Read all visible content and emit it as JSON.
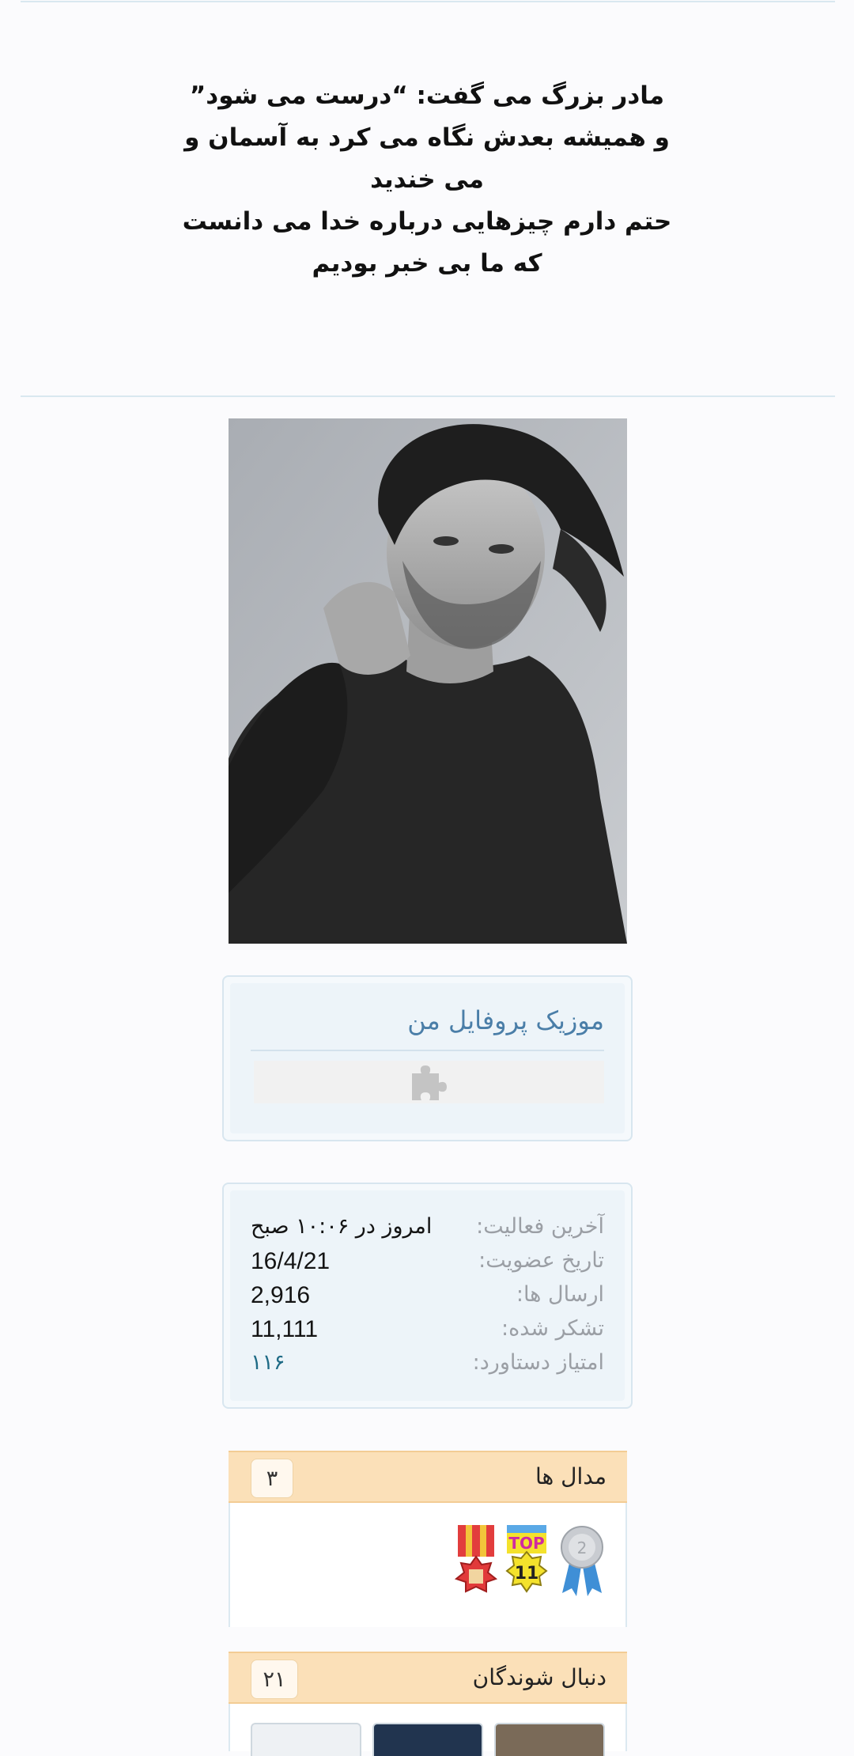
{
  "quote": {
    "line1": "مادر بزرگ می گفت: “درست می شود”",
    "line2": "و همیشه بعدش نگاه می کرد به آسمان و",
    "line3": "می خندید",
    "line4": "حتم دارم چیزهایی درباره خدا می دانست",
    "line5": "که ما بی خبر بودیم"
  },
  "music": {
    "title": "موزیک پروفایل من",
    "player_icon": "puzzle-piece-icon"
  },
  "info": {
    "rows": [
      {
        "label": "آخرین فعالیت:",
        "value": "امروز در ۱۰:۰۶ صبح"
      },
      {
        "label": "تاریخ عضویت:",
        "value": "16/4/21"
      },
      {
        "label": "ارسال ها:",
        "value": "2,916"
      },
      {
        "label": "تشکر شده:",
        "value": "11,111"
      },
      {
        "label": "امتیاز دستاورد:",
        "value": "۱۱۶"
      }
    ]
  },
  "medals": {
    "title": "مدال ها",
    "count": "۳",
    "badge_top": "TOP",
    "badge_num": "11"
  },
  "followers": {
    "title": "دنبال شوندگان",
    "count": "۲۱"
  },
  "colors": {
    "accent": "#4a7ea8",
    "section_header": "#fbe0b8",
    "link": "#1f6b86"
  }
}
